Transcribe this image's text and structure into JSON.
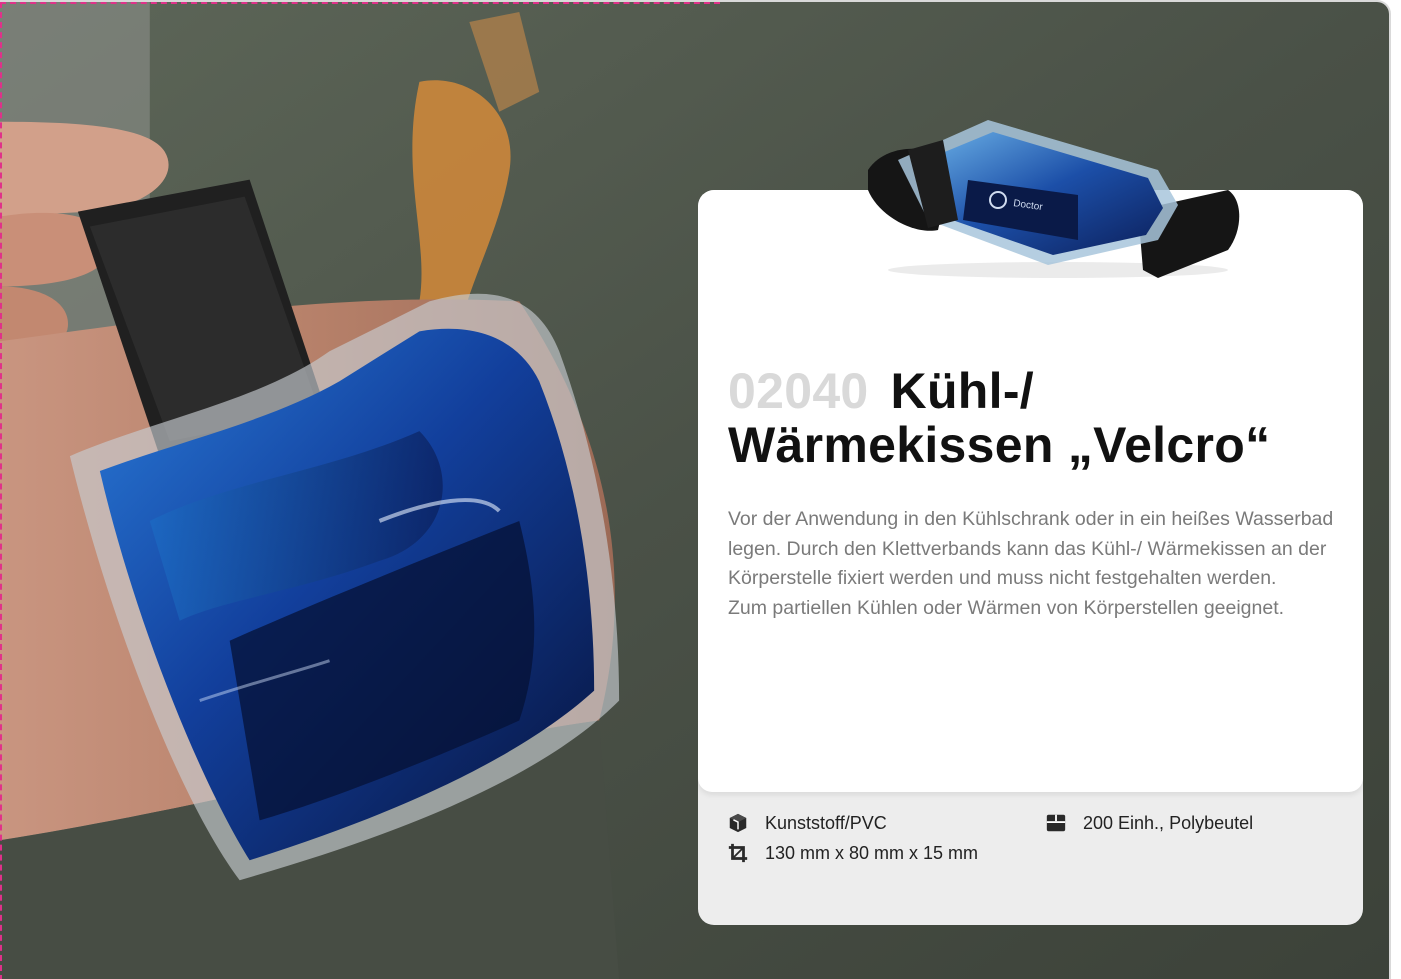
{
  "product": {
    "article_number": "02040",
    "title": "Kühl-/ Wärmekissen „Velcro“",
    "description": [
      "Vor der Anwendung in den Kühlschrank oder in ein heißes Wasserbad legen. Durch den Klettverbands kann das Kühl-/ Wärmekissen an der Körperstelle fixiert werden und muss nicht festgehalten werden.",
      "Zum partiellen Kühlen oder Wärmen von Körperstellen geeignet."
    ],
    "product_image_label": "Doctor"
  },
  "specs": {
    "material": {
      "icon": "cube-icon",
      "text": "Kunststoff/PVC"
    },
    "size": {
      "icon": "crop-icon",
      "text": "130 mm x 80 mm x 15 mm"
    },
    "packaging": {
      "icon": "box-icon",
      "text": "200 Einh., Polybeutel"
    }
  },
  "colors": {
    "article_number": "#d9d9d9",
    "title": "#111111",
    "description": "#7a7a7a",
    "card_bottom": "#ededed",
    "cut_line": "#e0318a"
  }
}
